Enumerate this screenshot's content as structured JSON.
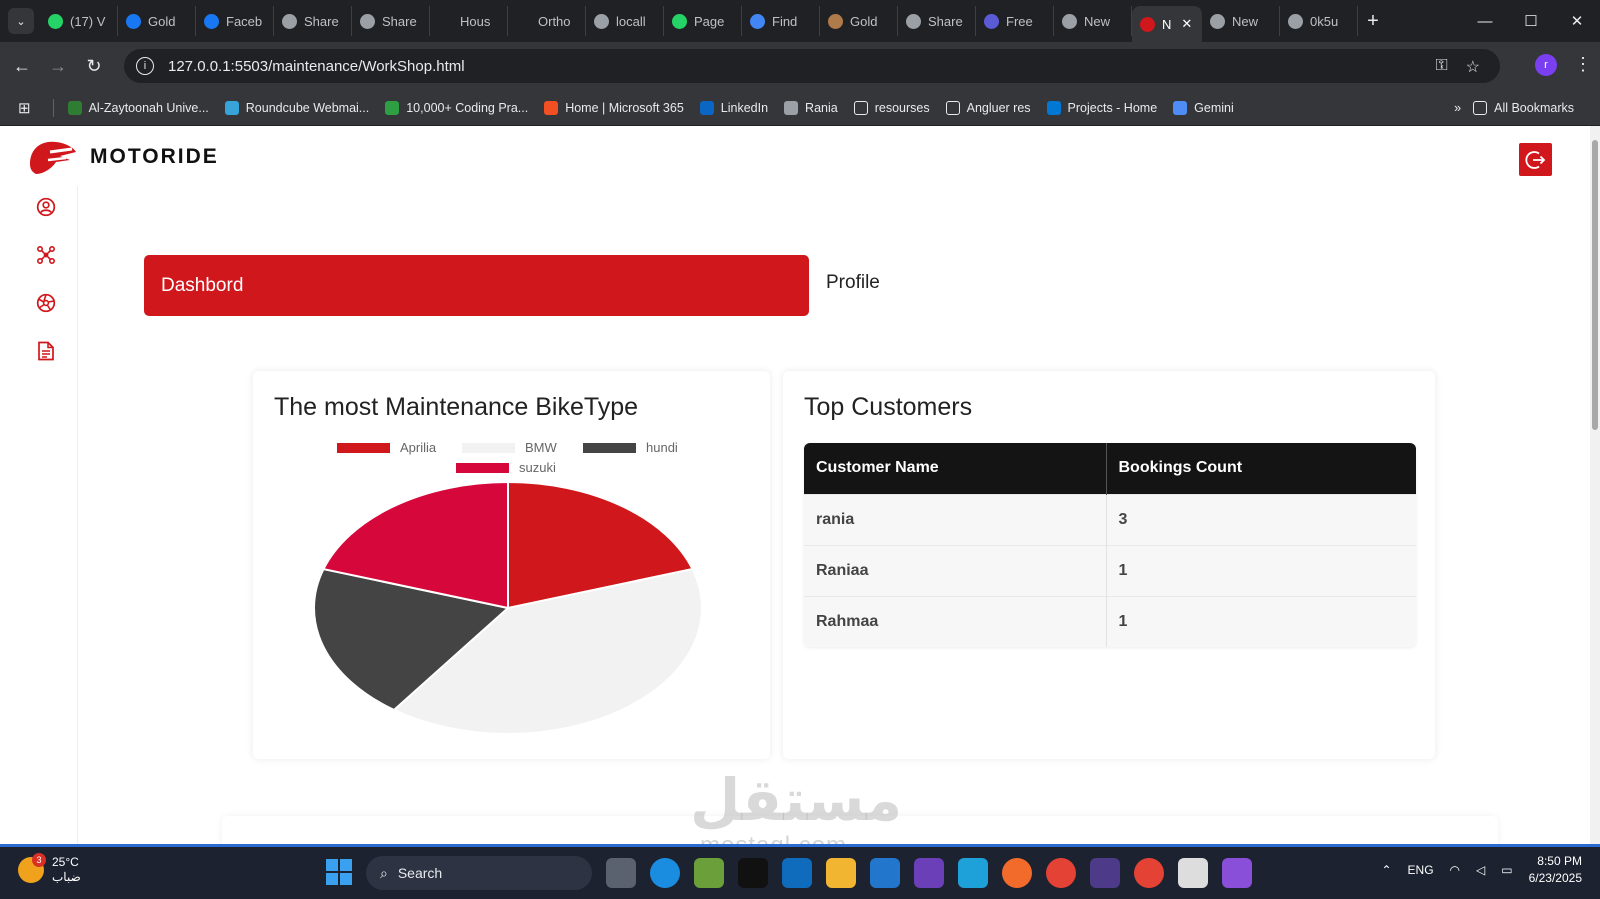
{
  "browser": {
    "tabs": [
      {
        "label": "(17) V",
        "icon": "whatsapp-icon",
        "color": "#25d366"
      },
      {
        "label": "Gold",
        "icon": "facebook-icon",
        "color": "#1877f2"
      },
      {
        "label": "Faceb",
        "icon": "facebook-icon",
        "color": "#1877f2"
      },
      {
        "label": "Share",
        "icon": "globe-icon",
        "color": "#9aa0a6"
      },
      {
        "label": "Share",
        "icon": "globe-icon",
        "color": "#9aa0a6"
      },
      {
        "label": "Hous",
        "icon": "is-icon",
        "color": "#202124"
      },
      {
        "label": "Ortho",
        "icon": "is-icon",
        "color": "#202124"
      },
      {
        "label": "locall",
        "icon": "globe-icon",
        "color": "#9aa0a6"
      },
      {
        "label": "Page",
        "icon": "whatsapp-icon",
        "color": "#25d366"
      },
      {
        "label": "Find",
        "icon": "flag-icon",
        "color": "#4285f4"
      },
      {
        "label": "Gold",
        "icon": "avatar-icon",
        "color": "#b07b4a"
      },
      {
        "label": "Share",
        "icon": "globe-icon",
        "color": "#9aa0a6"
      },
      {
        "label": "Free",
        "icon": "bracket-icon",
        "color": "#5b5bd6"
      },
      {
        "label": "New",
        "icon": "globe-icon",
        "color": "#9aa0a6"
      },
      {
        "label": "N",
        "icon": "motoride-icon",
        "color": "#d0171c",
        "active": true
      },
      {
        "label": "New",
        "icon": "globe-icon",
        "color": "#9aa0a6"
      },
      {
        "label": "0k5u",
        "icon": "globe-icon",
        "color": "#9aa0a6"
      }
    ],
    "url": "127.0.0.1:5503/maintenance/WorkShop.html",
    "profile_initial": "r",
    "bookmarks": [
      {
        "label": "Al-Zaytoonah Unive...",
        "color": "#2e7d32"
      },
      {
        "label": "Roundcube Webmai...",
        "color": "#37a3d8"
      },
      {
        "label": "10,000+ Coding Pra...",
        "color": "#2ea043"
      },
      {
        "label": "Home | Microsoft 365",
        "color": "#f25022"
      },
      {
        "label": "LinkedIn",
        "color": "#0a66c2"
      },
      {
        "label": "Rania",
        "color": "#9aa0a6"
      },
      {
        "label": "resourses",
        "color": "transparent"
      },
      {
        "label": "Angluer res",
        "color": "transparent"
      },
      {
        "label": "Projects - Home",
        "color": "#0078d4"
      },
      {
        "label": "Gemini",
        "color": "#4f8df5"
      }
    ],
    "all_bookmarks": "All Bookmarks"
  },
  "app": {
    "brand": "MOTORIDE",
    "accent": "#d0171c",
    "nav_tabs": {
      "dashboard": "Dashbord",
      "profile": "Profile"
    },
    "sidebar_icons": [
      "user-circle-icon",
      "service-icon",
      "wheel-icon",
      "document-icon"
    ],
    "pie_card": {
      "title": "The most Maintenance BikeType"
    },
    "customers_card": {
      "title": "Top Customers",
      "columns": [
        "Customer Name",
        "Bookings Count"
      ],
      "rows": [
        {
          "name": "rania",
          "count": "3"
        },
        {
          "name": "Raniaa",
          "count": "1"
        },
        {
          "name": "Rahmaa",
          "count": "1"
        }
      ]
    }
  },
  "chart_data": {
    "type": "pie",
    "title": "The most Maintenance BikeType",
    "categories": [
      "Aprilia",
      "BMW",
      "hundi",
      "suzuki"
    ],
    "values": [
      1,
      2,
      1,
      1
    ],
    "colors": [
      "#d0171c",
      "#f2f2f2",
      "#444444",
      "#d6083b"
    ],
    "legend": "top"
  },
  "watermark": {
    "text": "مستقل",
    "sub": "mostaql.com"
  },
  "taskbar": {
    "weather_temp": "25°C",
    "weather_desc": "ضباب",
    "weather_badge": "3",
    "search_label": "Search",
    "lang": "ENG",
    "time": "8:50 PM",
    "date": "6/23/2025"
  }
}
